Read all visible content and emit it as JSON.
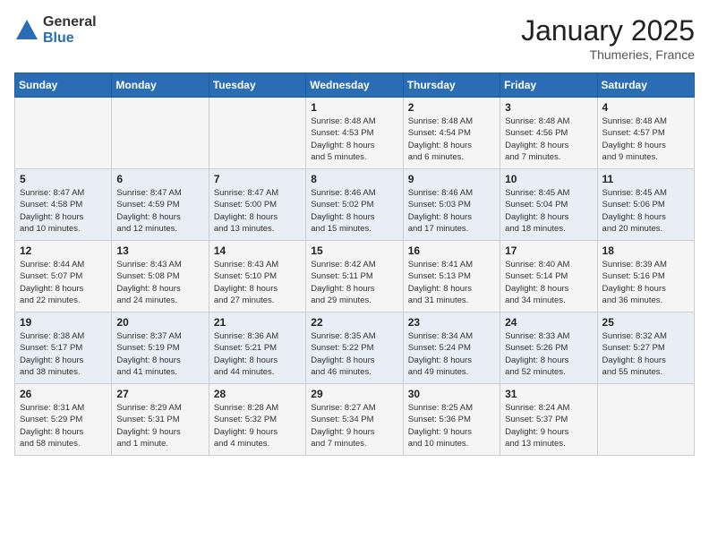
{
  "logo": {
    "general": "General",
    "blue": "Blue"
  },
  "title": "January 2025",
  "location": "Thumeries, France",
  "days_of_week": [
    "Sunday",
    "Monday",
    "Tuesday",
    "Wednesday",
    "Thursday",
    "Friday",
    "Saturday"
  ],
  "weeks": [
    [
      {
        "day": "",
        "info": ""
      },
      {
        "day": "",
        "info": ""
      },
      {
        "day": "",
        "info": ""
      },
      {
        "day": "1",
        "info": "Sunrise: 8:48 AM\nSunset: 4:53 PM\nDaylight: 8 hours\nand 5 minutes."
      },
      {
        "day": "2",
        "info": "Sunrise: 8:48 AM\nSunset: 4:54 PM\nDaylight: 8 hours\nand 6 minutes."
      },
      {
        "day": "3",
        "info": "Sunrise: 8:48 AM\nSunset: 4:56 PM\nDaylight: 8 hours\nand 7 minutes."
      },
      {
        "day": "4",
        "info": "Sunrise: 8:48 AM\nSunset: 4:57 PM\nDaylight: 8 hours\nand 9 minutes."
      }
    ],
    [
      {
        "day": "5",
        "info": "Sunrise: 8:47 AM\nSunset: 4:58 PM\nDaylight: 8 hours\nand 10 minutes."
      },
      {
        "day": "6",
        "info": "Sunrise: 8:47 AM\nSunset: 4:59 PM\nDaylight: 8 hours\nand 12 minutes."
      },
      {
        "day": "7",
        "info": "Sunrise: 8:47 AM\nSunset: 5:00 PM\nDaylight: 8 hours\nand 13 minutes."
      },
      {
        "day": "8",
        "info": "Sunrise: 8:46 AM\nSunset: 5:02 PM\nDaylight: 8 hours\nand 15 minutes."
      },
      {
        "day": "9",
        "info": "Sunrise: 8:46 AM\nSunset: 5:03 PM\nDaylight: 8 hours\nand 17 minutes."
      },
      {
        "day": "10",
        "info": "Sunrise: 8:45 AM\nSunset: 5:04 PM\nDaylight: 8 hours\nand 18 minutes."
      },
      {
        "day": "11",
        "info": "Sunrise: 8:45 AM\nSunset: 5:06 PM\nDaylight: 8 hours\nand 20 minutes."
      }
    ],
    [
      {
        "day": "12",
        "info": "Sunrise: 8:44 AM\nSunset: 5:07 PM\nDaylight: 8 hours\nand 22 minutes."
      },
      {
        "day": "13",
        "info": "Sunrise: 8:43 AM\nSunset: 5:08 PM\nDaylight: 8 hours\nand 24 minutes."
      },
      {
        "day": "14",
        "info": "Sunrise: 8:43 AM\nSunset: 5:10 PM\nDaylight: 8 hours\nand 27 minutes."
      },
      {
        "day": "15",
        "info": "Sunrise: 8:42 AM\nSunset: 5:11 PM\nDaylight: 8 hours\nand 29 minutes."
      },
      {
        "day": "16",
        "info": "Sunrise: 8:41 AM\nSunset: 5:13 PM\nDaylight: 8 hours\nand 31 minutes."
      },
      {
        "day": "17",
        "info": "Sunrise: 8:40 AM\nSunset: 5:14 PM\nDaylight: 8 hours\nand 34 minutes."
      },
      {
        "day": "18",
        "info": "Sunrise: 8:39 AM\nSunset: 5:16 PM\nDaylight: 8 hours\nand 36 minutes."
      }
    ],
    [
      {
        "day": "19",
        "info": "Sunrise: 8:38 AM\nSunset: 5:17 PM\nDaylight: 8 hours\nand 38 minutes."
      },
      {
        "day": "20",
        "info": "Sunrise: 8:37 AM\nSunset: 5:19 PM\nDaylight: 8 hours\nand 41 minutes."
      },
      {
        "day": "21",
        "info": "Sunrise: 8:36 AM\nSunset: 5:21 PM\nDaylight: 8 hours\nand 44 minutes."
      },
      {
        "day": "22",
        "info": "Sunrise: 8:35 AM\nSunset: 5:22 PM\nDaylight: 8 hours\nand 46 minutes."
      },
      {
        "day": "23",
        "info": "Sunrise: 8:34 AM\nSunset: 5:24 PM\nDaylight: 8 hours\nand 49 minutes."
      },
      {
        "day": "24",
        "info": "Sunrise: 8:33 AM\nSunset: 5:26 PM\nDaylight: 8 hours\nand 52 minutes."
      },
      {
        "day": "25",
        "info": "Sunrise: 8:32 AM\nSunset: 5:27 PM\nDaylight: 8 hours\nand 55 minutes."
      }
    ],
    [
      {
        "day": "26",
        "info": "Sunrise: 8:31 AM\nSunset: 5:29 PM\nDaylight: 8 hours\nand 58 minutes."
      },
      {
        "day": "27",
        "info": "Sunrise: 8:29 AM\nSunset: 5:31 PM\nDaylight: 9 hours\nand 1 minute."
      },
      {
        "day": "28",
        "info": "Sunrise: 8:28 AM\nSunset: 5:32 PM\nDaylight: 9 hours\nand 4 minutes."
      },
      {
        "day": "29",
        "info": "Sunrise: 8:27 AM\nSunset: 5:34 PM\nDaylight: 9 hours\nand 7 minutes."
      },
      {
        "day": "30",
        "info": "Sunrise: 8:25 AM\nSunset: 5:36 PM\nDaylight: 9 hours\nand 10 minutes."
      },
      {
        "day": "31",
        "info": "Sunrise: 8:24 AM\nSunset: 5:37 PM\nDaylight: 9 hours\nand 13 minutes."
      },
      {
        "day": "",
        "info": ""
      }
    ]
  ]
}
